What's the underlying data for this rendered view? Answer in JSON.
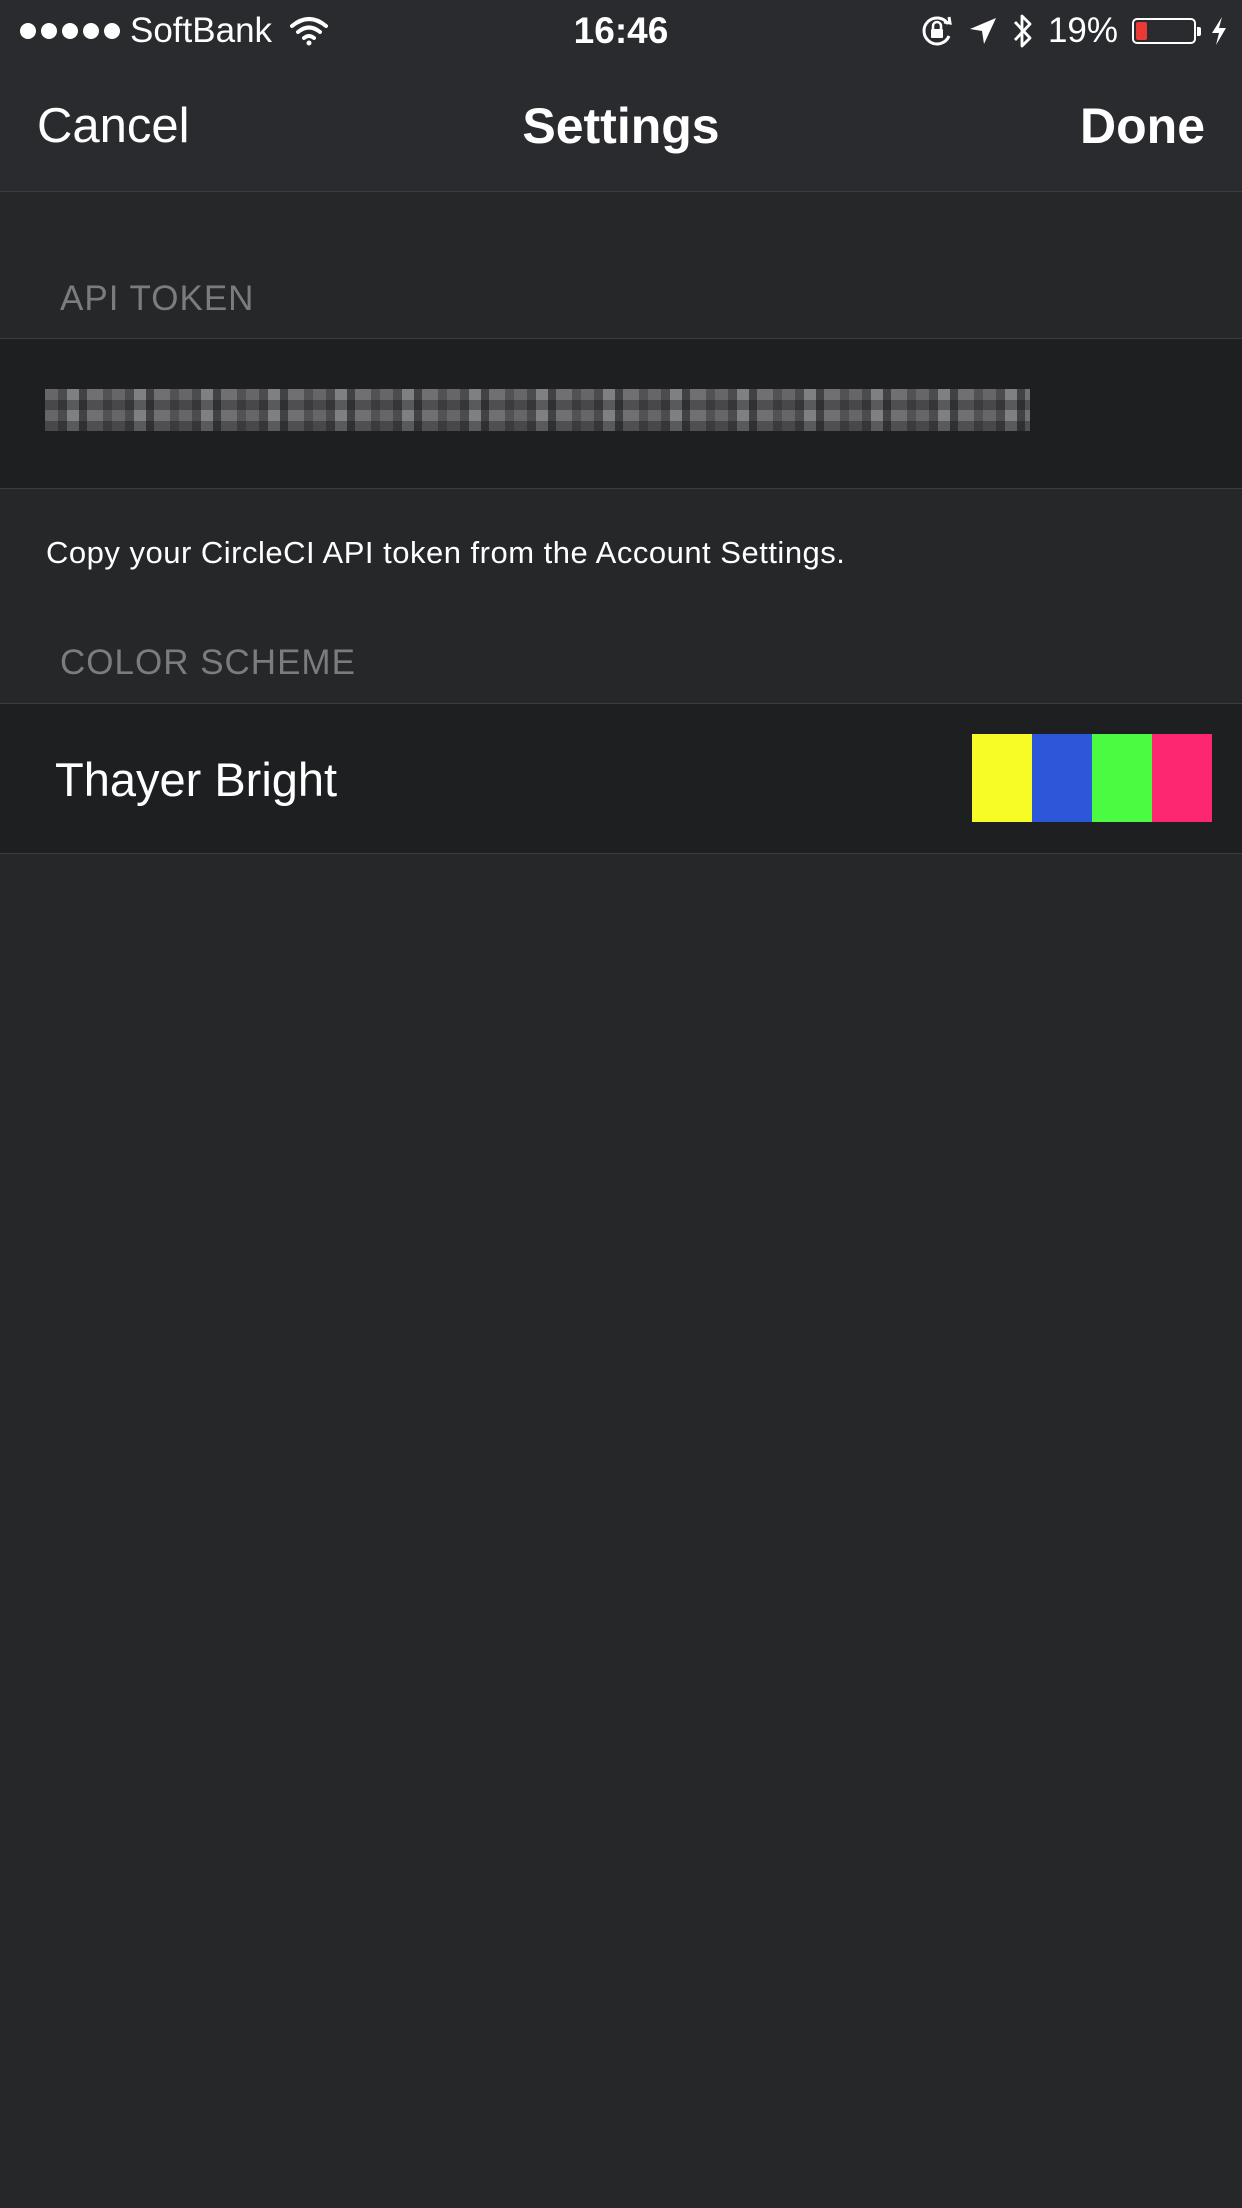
{
  "status_bar": {
    "carrier": "SoftBank",
    "time": "16:46",
    "battery_percent": "19%",
    "battery_level": 0.19,
    "battery_color": "#e93a35",
    "icons": [
      "signal-dots",
      "wifi-icon",
      "orientation-lock-icon",
      "location-arrow-icon",
      "bluetooth-icon",
      "battery-icon",
      "charging-bolt-icon"
    ]
  },
  "nav": {
    "cancel_label": "Cancel",
    "title": "Settings",
    "done_label": "Done"
  },
  "api_token": {
    "header": "API TOKEN",
    "value_obscured": true,
    "footer": "Copy your CircleCI API token from the Account Settings."
  },
  "color_scheme": {
    "header": "COLOR SCHEME",
    "selected_name": "Thayer Bright",
    "swatches": [
      "#f8fc26",
      "#2c57d8",
      "#4bfb42",
      "#fc2770"
    ]
  },
  "colors": {
    "background": "#262729",
    "cell_background": "#1e1f21",
    "section_header": "#7b7c80"
  }
}
